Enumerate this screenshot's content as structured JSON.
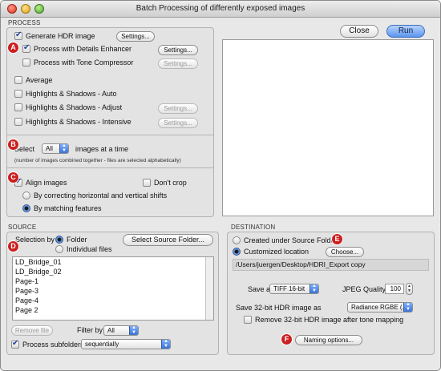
{
  "window": {
    "title": "Batch Processing of differently exposed images"
  },
  "process": {
    "section_label": "PROCESS",
    "generate_hdr": {
      "label": "Generate HDR image",
      "checked": true,
      "settings": "Settings..."
    },
    "details_enhancer": {
      "label": "Process with Details Enhancer",
      "checked": true,
      "settings": "Settings..."
    },
    "tone_compressor": {
      "label": "Process with Tone Compressor",
      "checked": false,
      "settings": "Settings..."
    },
    "average": {
      "label": "Average",
      "checked": false
    },
    "hs_auto": {
      "label": "Highlights & Shadows - Auto",
      "checked": false
    },
    "hs_adjust": {
      "label": "Highlights & Shadows - Adjust",
      "checked": false,
      "settings": "Settings..."
    },
    "hs_intensive": {
      "label": "Highlights & Shadows - Intensive",
      "checked": false,
      "settings": "Settings..."
    },
    "select_label": "Select",
    "select_value": "All",
    "select_suffix": "images at a time",
    "select_note": "(number of images combined together - files are selected alphabetically)",
    "align": {
      "label": "Align images",
      "checked": true
    },
    "dont_crop": {
      "label": "Don't crop",
      "checked": false
    },
    "align_method_1": {
      "label": "By correcting horizontal and vertical shifts",
      "selected": false
    },
    "align_method_2": {
      "label": "By matching features",
      "selected": true
    }
  },
  "toolbar": {
    "close_label": "Close",
    "run_label": "Run"
  },
  "source": {
    "section_label": "SOURCE",
    "selection_by_label": "Selection by",
    "folder_label": "Folder",
    "individual_label": "Individual files",
    "select_folder_button": "Select Source Folder...",
    "files": [
      "LD_Bridge_01",
      "LD_Bridge_02",
      "Page-1",
      "Page-3",
      "Page-4",
      "Page 2"
    ],
    "remove_file": "Remove file",
    "filter_label": "Filter by",
    "filter_value": "All",
    "subfolders": {
      "label": "Process subfolders",
      "checked": true
    },
    "subfolder_mode": "sequentially"
  },
  "destination": {
    "section_label": "DESTINATION",
    "created_under_label": "Created under Source Folder",
    "customized_label": "Customized location",
    "choose_button": "Choose...",
    "path": "/Users/juergen/Desktop/HDRI_Export copy",
    "save_as_label": "Save as",
    "save_as_value": "TIFF 16-bit",
    "jpeg_quality_label": "JPEG Quality:",
    "jpeg_quality_value": "100",
    "save32_label": "Save 32-bit HDR image as",
    "save32_value": "Radiance RGBE (.hdr)",
    "remove32": {
      "label": "Remove 32-bit HDR image after tone mapping",
      "checked": false
    },
    "naming_button": "Naming options..."
  },
  "badges": {
    "a": "A",
    "b": "B",
    "c": "C",
    "d": "D",
    "e": "E",
    "f": "F"
  },
  "colors": {
    "badge": "#cc1f1f",
    "run_button": "#5a95ee",
    "checkmark": "#1a3d9a"
  }
}
